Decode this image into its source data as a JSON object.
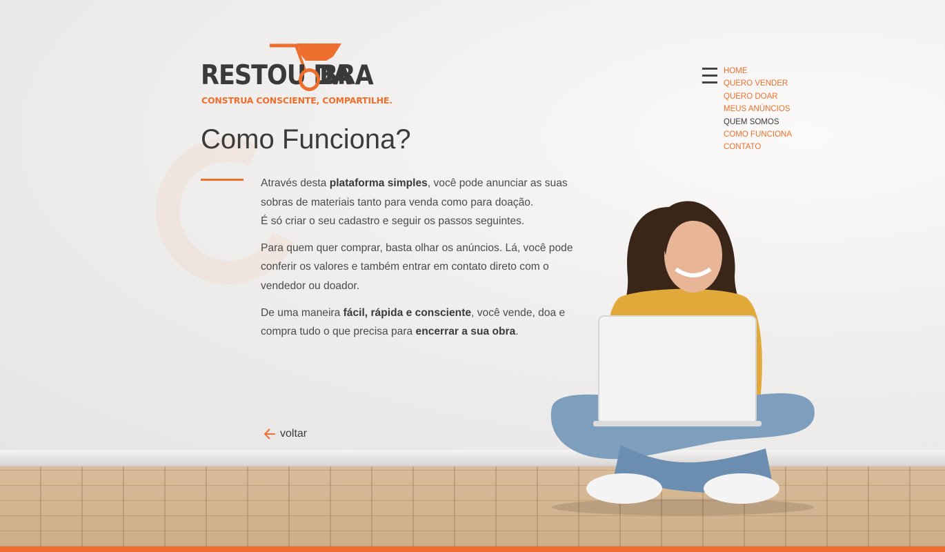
{
  "logo": {
    "word_left": "RESTOU DA",
    "word_right": "BRA",
    "tagline": "CONSTRUA CONSCIENTE, COMPARTILHE."
  },
  "nav": {
    "items": [
      {
        "label": "HOME",
        "active": false
      },
      {
        "label": "QUERO VENDER",
        "active": false
      },
      {
        "label": "QUERO DOAR",
        "active": false
      },
      {
        "label": "MEUS ANÚNCIOS",
        "active": false
      },
      {
        "label": "QUEM SOMOS",
        "active": true
      },
      {
        "label": "COMO FUNCIONA",
        "active": false
      },
      {
        "label": "CONTATO",
        "active": false
      }
    ]
  },
  "page": {
    "title": "Como Funciona?",
    "p1_a": "Através desta ",
    "p1_b": "plataforma simples",
    "p1_c": ", você pode anunciar as suas sobras de materiais tanto para venda como para doação.",
    "p1_d": "É só criar o seu cadastro e seguir os passos seguintes.",
    "p2": "Para quem quer comprar, basta olhar os anúncios. Lá, você pode conferir os valores e também entrar em contato direto com o vendedor ou doador.",
    "p3_a": "De uma maneira ",
    "p3_b": "fácil, rápida e consciente",
    "p3_c": ", você vende, doa e compra tudo o que precisa para ",
    "p3_d": "encerrar a sua obra",
    "p3_e": ".",
    "back_label": "voltar"
  },
  "colors": {
    "accent": "#ee6f2d",
    "text": "#3b3b3b"
  },
  "icons": {
    "menu": "hamburger-icon",
    "back": "arrow-left-icon",
    "logo_mark": "wheelbarrow-icon"
  }
}
